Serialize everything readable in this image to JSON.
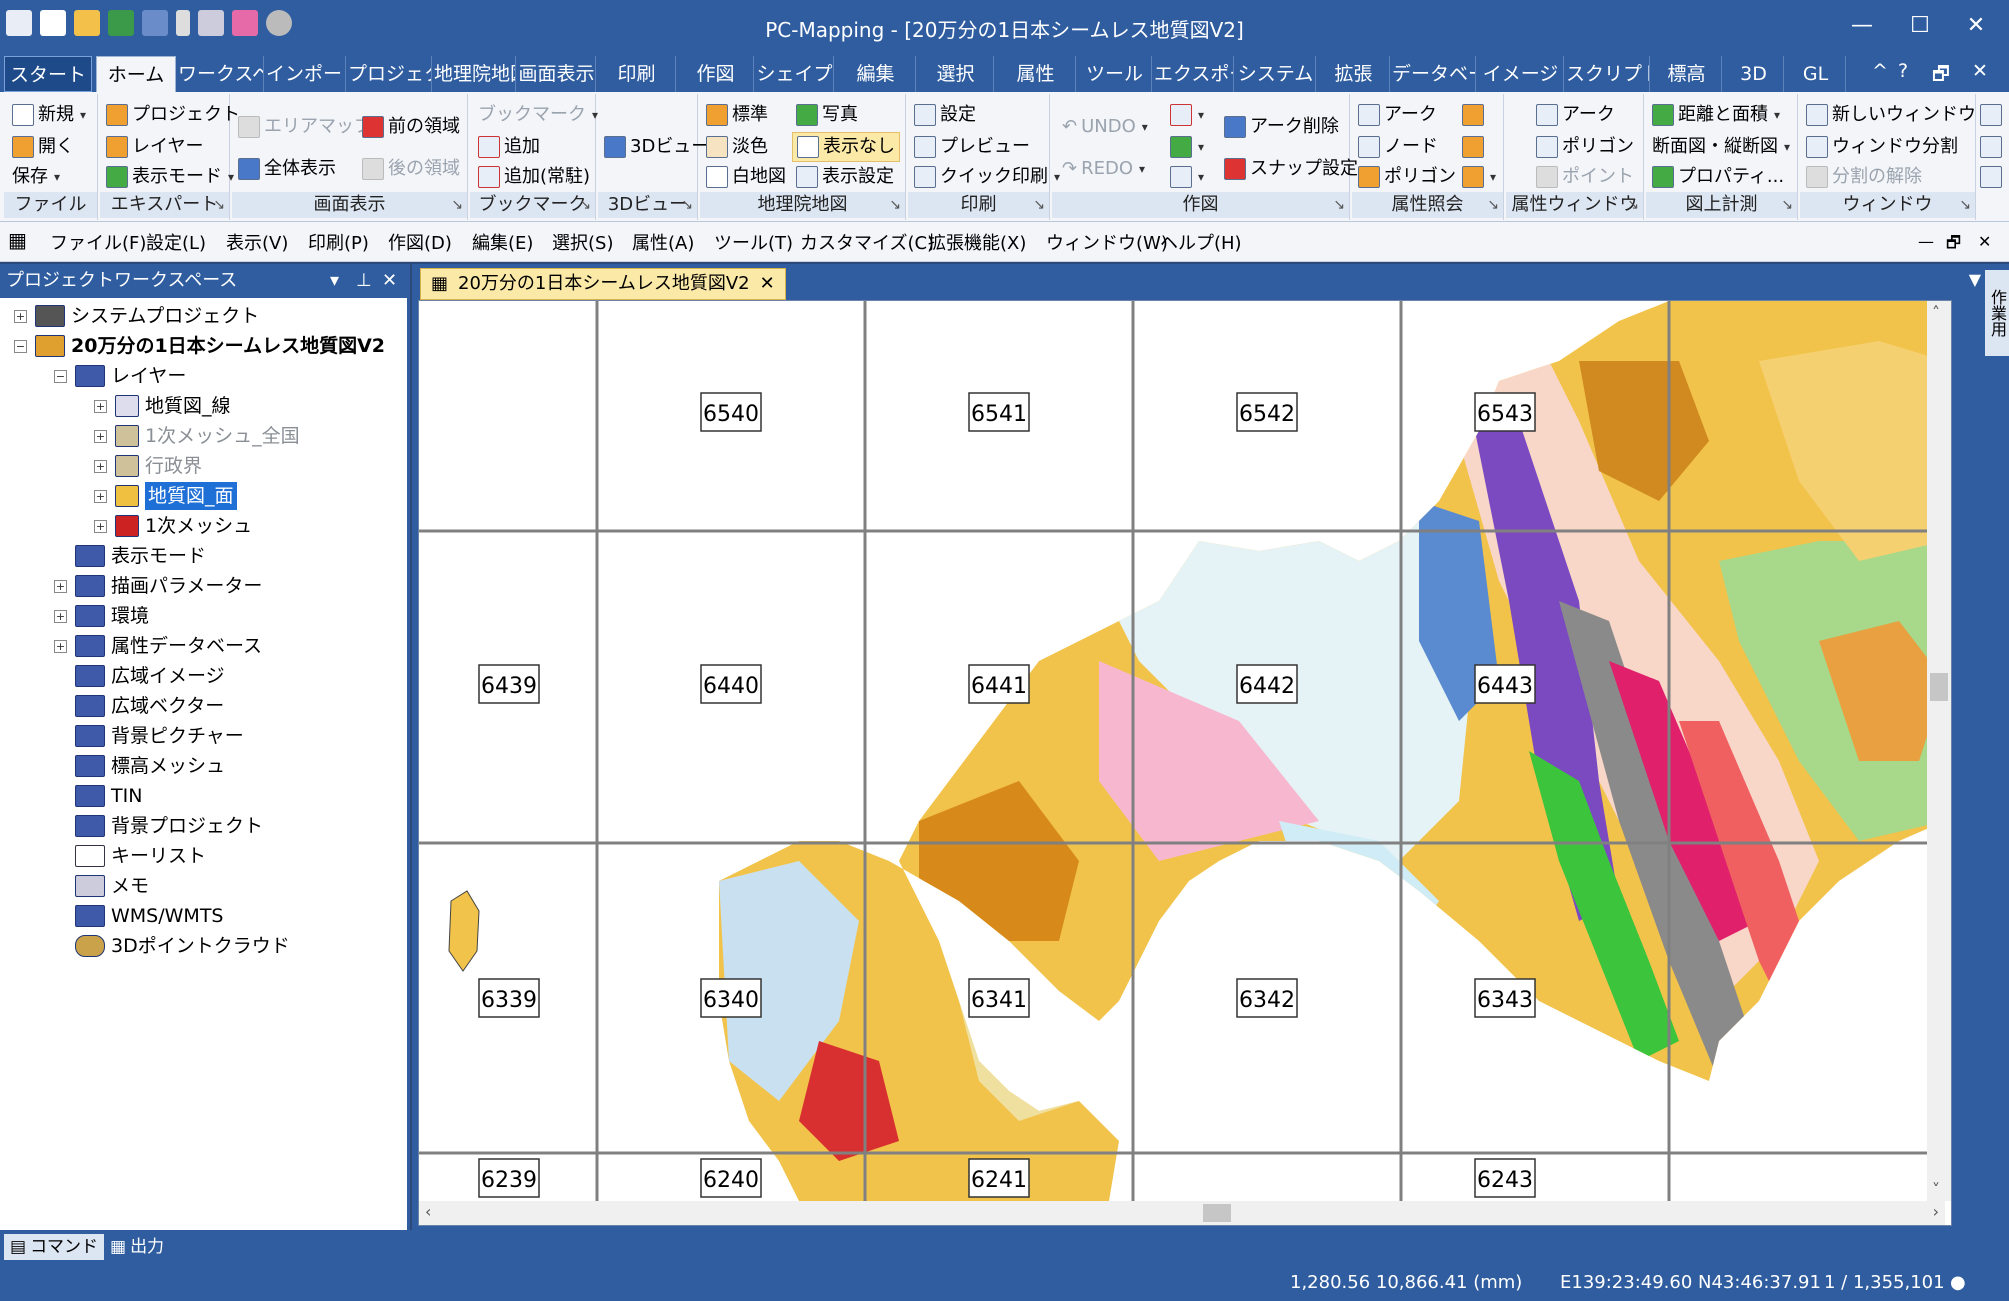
{
  "window": {
    "title": "PC-Mapping - [20万分の1日本シームレス地質図V2]",
    "minimize": "—",
    "maximize": "☐",
    "close": "✕"
  },
  "ribbon_tabs": [
    "スタート",
    "ホーム",
    "ワークスペー",
    "インポート",
    "プロジェクト",
    "地理院地図",
    "画面表示",
    "印刷",
    "作図",
    "シェイプ",
    "編集",
    "選択",
    "属性",
    "ツール",
    "エクスポート",
    "システム",
    "拡張",
    "データベース",
    "イメージ",
    "スクリプト",
    "標高",
    "3D",
    "GL"
  ],
  "ribbon_tab_controls": {
    "collapse": "^",
    "help": "?",
    "restore": "🗗",
    "close": "✕"
  },
  "ribbon_groups": {
    "file": {
      "label": "ファイル",
      "new": "新規",
      "open": "開く",
      "save": "保存"
    },
    "expert": {
      "label": "エキスパート",
      "project": "プロジェクト",
      "layer": "レイヤー",
      "display_mode": "表示モード"
    },
    "screen": {
      "label": "画面表示",
      "area_map": "エリアマップ",
      "fit_all": "全体表示",
      "prev_area": "前の領域",
      "next_area": "後の領域"
    },
    "bookmark": {
      "label": "ブックマーク",
      "bookmark": "ブックマーク",
      "add": "追加",
      "add_resident": "追加(常駐)"
    },
    "view3d": {
      "label": "3Dビュー",
      "view": "3Dビュー"
    },
    "gsi": {
      "label": "地理院地図",
      "standard": "標準",
      "pale": "淡色",
      "blank": "白地図",
      "photo": "写真",
      "none": "表示なし",
      "display_settings": "表示設定"
    },
    "print": {
      "label": "印刷",
      "settings": "設定",
      "preview": "プレビュー",
      "quick_print": "クイック印刷"
    },
    "draw": {
      "label": "作図",
      "undo": "UNDO",
      "redo": "REDO",
      "arc_delete": "アーク削除",
      "snap_settings": "スナップ設定"
    },
    "attr_query": {
      "label": "属性照会",
      "arc": "アーク",
      "node": "ノード",
      "polygon": "ポリゴン"
    },
    "attr_window": {
      "label": "属性ウィンドウ",
      "arc": "アーク",
      "polygon": "ポリゴン",
      "point": "ポイント"
    },
    "measure": {
      "label": "図上計測",
      "distance_area": "距離と面積",
      "section": "断面図・縦断図",
      "properties": "プロパティ..."
    },
    "window": {
      "label": "ウィンドウ",
      "new_window": "新しいウィンドウ",
      "split": "ウィンドウ分割",
      "unsplit": "分割の解除"
    }
  },
  "menubar": [
    "ファイル(F)",
    "設定(L)",
    "表示(V)",
    "印刷(P)",
    "作図(D)",
    "編集(E)",
    "選択(S)",
    "属性(A)",
    "ツール(T)",
    "カスタマイズ(C)",
    "拡張機能(X)",
    "ウィンドウ(W)",
    "ヘルプ(H)"
  ],
  "workspace": {
    "title": "プロジェクトワークスペース",
    "nodes": [
      {
        "label": "システムプロジェクト"
      },
      {
        "label": "20万分の1日本シームレス地質図V2"
      },
      {
        "label": "レイヤー"
      },
      {
        "label": "地質図_線"
      },
      {
        "label": "1次メッシュ_全国"
      },
      {
        "label": "行政界"
      },
      {
        "label": "地質図_面"
      },
      {
        "label": "1次メッシュ"
      },
      {
        "label": "表示モード"
      },
      {
        "label": "描画パラメーター"
      },
      {
        "label": "環境"
      },
      {
        "label": "属性データベース"
      },
      {
        "label": "広域イメージ"
      },
      {
        "label": "広域ベクター"
      },
      {
        "label": "背景ピクチャー"
      },
      {
        "label": "標高メッシュ"
      },
      {
        "label": "TIN"
      },
      {
        "label": "背景プロジェクト"
      },
      {
        "label": "キーリスト"
      },
      {
        "label": "メモ"
      },
      {
        "label": "WMS/WMTS"
      },
      {
        "label": "3Dポイントクラウド"
      }
    ]
  },
  "document": {
    "tab_title": "20万分の1日本シームレス地質図V2",
    "close": "✕",
    "mesh_labels": [
      "6540",
      "6541",
      "6542",
      "6543",
      "6439",
      "6440",
      "6441",
      "6442",
      "6443",
      "6339",
      "6340",
      "6341",
      "6342",
      "6343",
      "6239",
      "6240",
      "6241",
      "6243"
    ]
  },
  "side_tab": "作業用",
  "bottom_tabs": {
    "command": "コマンド",
    "output": "出力"
  },
  "status": {
    "coords_mm": "1,280.56 10,866.41 (mm)",
    "latlon": "E139:23:49.60 N43:46:37.91",
    "scale": "1 / 1,355,101"
  },
  "colors": {
    "frame": "#2f5d9f",
    "ribbon_bg": "#f3f5f9",
    "highlight": "#fbe9a8",
    "selection": "#1e6fd6"
  }
}
